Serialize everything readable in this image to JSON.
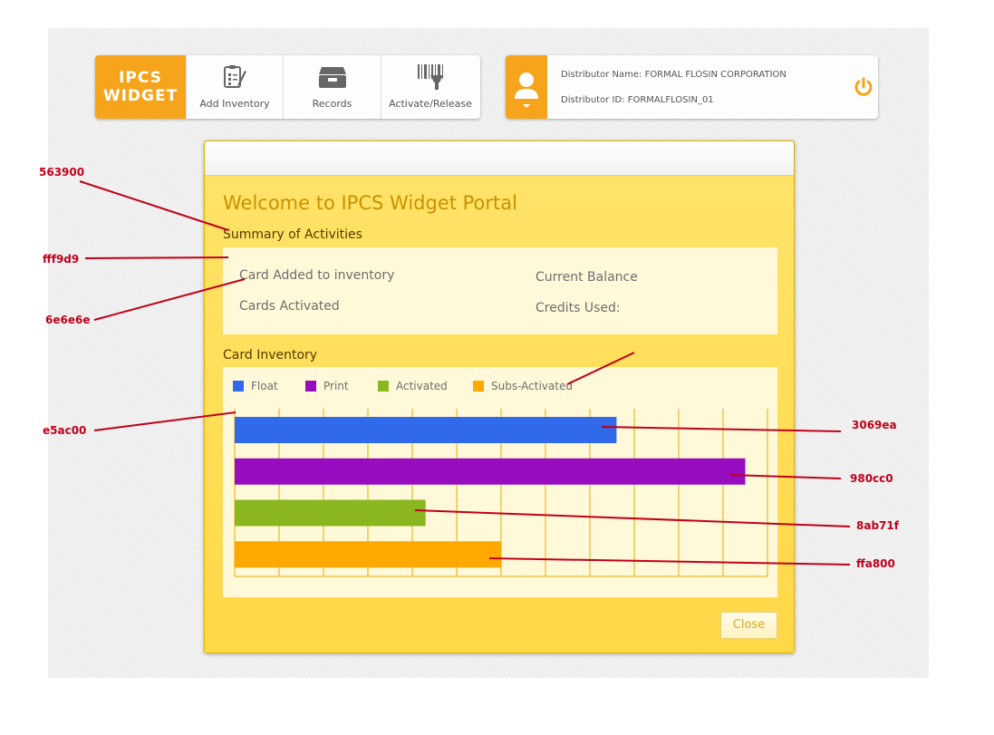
{
  "nav": {
    "logo_line1": "IPCS",
    "logo_line2": "WIDGET",
    "items": [
      {
        "label": "Add Inventory",
        "icon": "clipboard-edit-icon"
      },
      {
        "label": "Records",
        "icon": "archive-box-icon"
      },
      {
        "label": "Activate/Release",
        "icon": "barcode-scanner-icon"
      }
    ]
  },
  "distributor": {
    "name_line": "Distributor Name: FORMAL  FLOSIN CORPORATION",
    "id_line": "Distributor ID: FORMALFLOSIN_01",
    "avatar_icon": "user-icon",
    "power_icon": "power-icon"
  },
  "modal": {
    "title": "Welcome to IPCS Widget Portal",
    "summary_title": "Summary of Activities",
    "summary": {
      "card_added": "Card Added to inventory",
      "cards_activated": "Cards Activated",
      "current_balance": "Current Balance",
      "credits_used": "Credits Used:"
    },
    "inventory_title": "Card Inventory",
    "close_label": "Close"
  },
  "chart_data": {
    "type": "bar",
    "orientation": "horizontal",
    "series": [
      {
        "name": "Float",
        "value": 8.6,
        "color": "#3069ea"
      },
      {
        "name": "Print",
        "value": 11.5,
        "color": "#980cc0"
      },
      {
        "name": "Activated",
        "value": 4.3,
        "color": "#8ab71f"
      },
      {
        "name": "Subs-Activated",
        "value": 6.0,
        "color": "#ffa800"
      }
    ],
    "xlim": [
      0,
      12
    ],
    "grid": true,
    "grid_color": "#e5ac00",
    "legend": "top-left"
  },
  "annotations": [
    {
      "text": "563900"
    },
    {
      "text": "fff9d9"
    },
    {
      "text": "6e6e6e"
    },
    {
      "text": "e5ac00"
    },
    {
      "text": "3069ea"
    },
    {
      "text": "980cc0"
    },
    {
      "text": "8ab71f"
    },
    {
      "text": "ffa800"
    }
  ],
  "colors": {
    "accent": "#f6a41b",
    "modal_bg": "#ffd84d",
    "title": "#c89200",
    "heading": "#563900",
    "panel": "#fff9d9",
    "text": "#6e6e6e",
    "annotation": "#c0001a"
  }
}
